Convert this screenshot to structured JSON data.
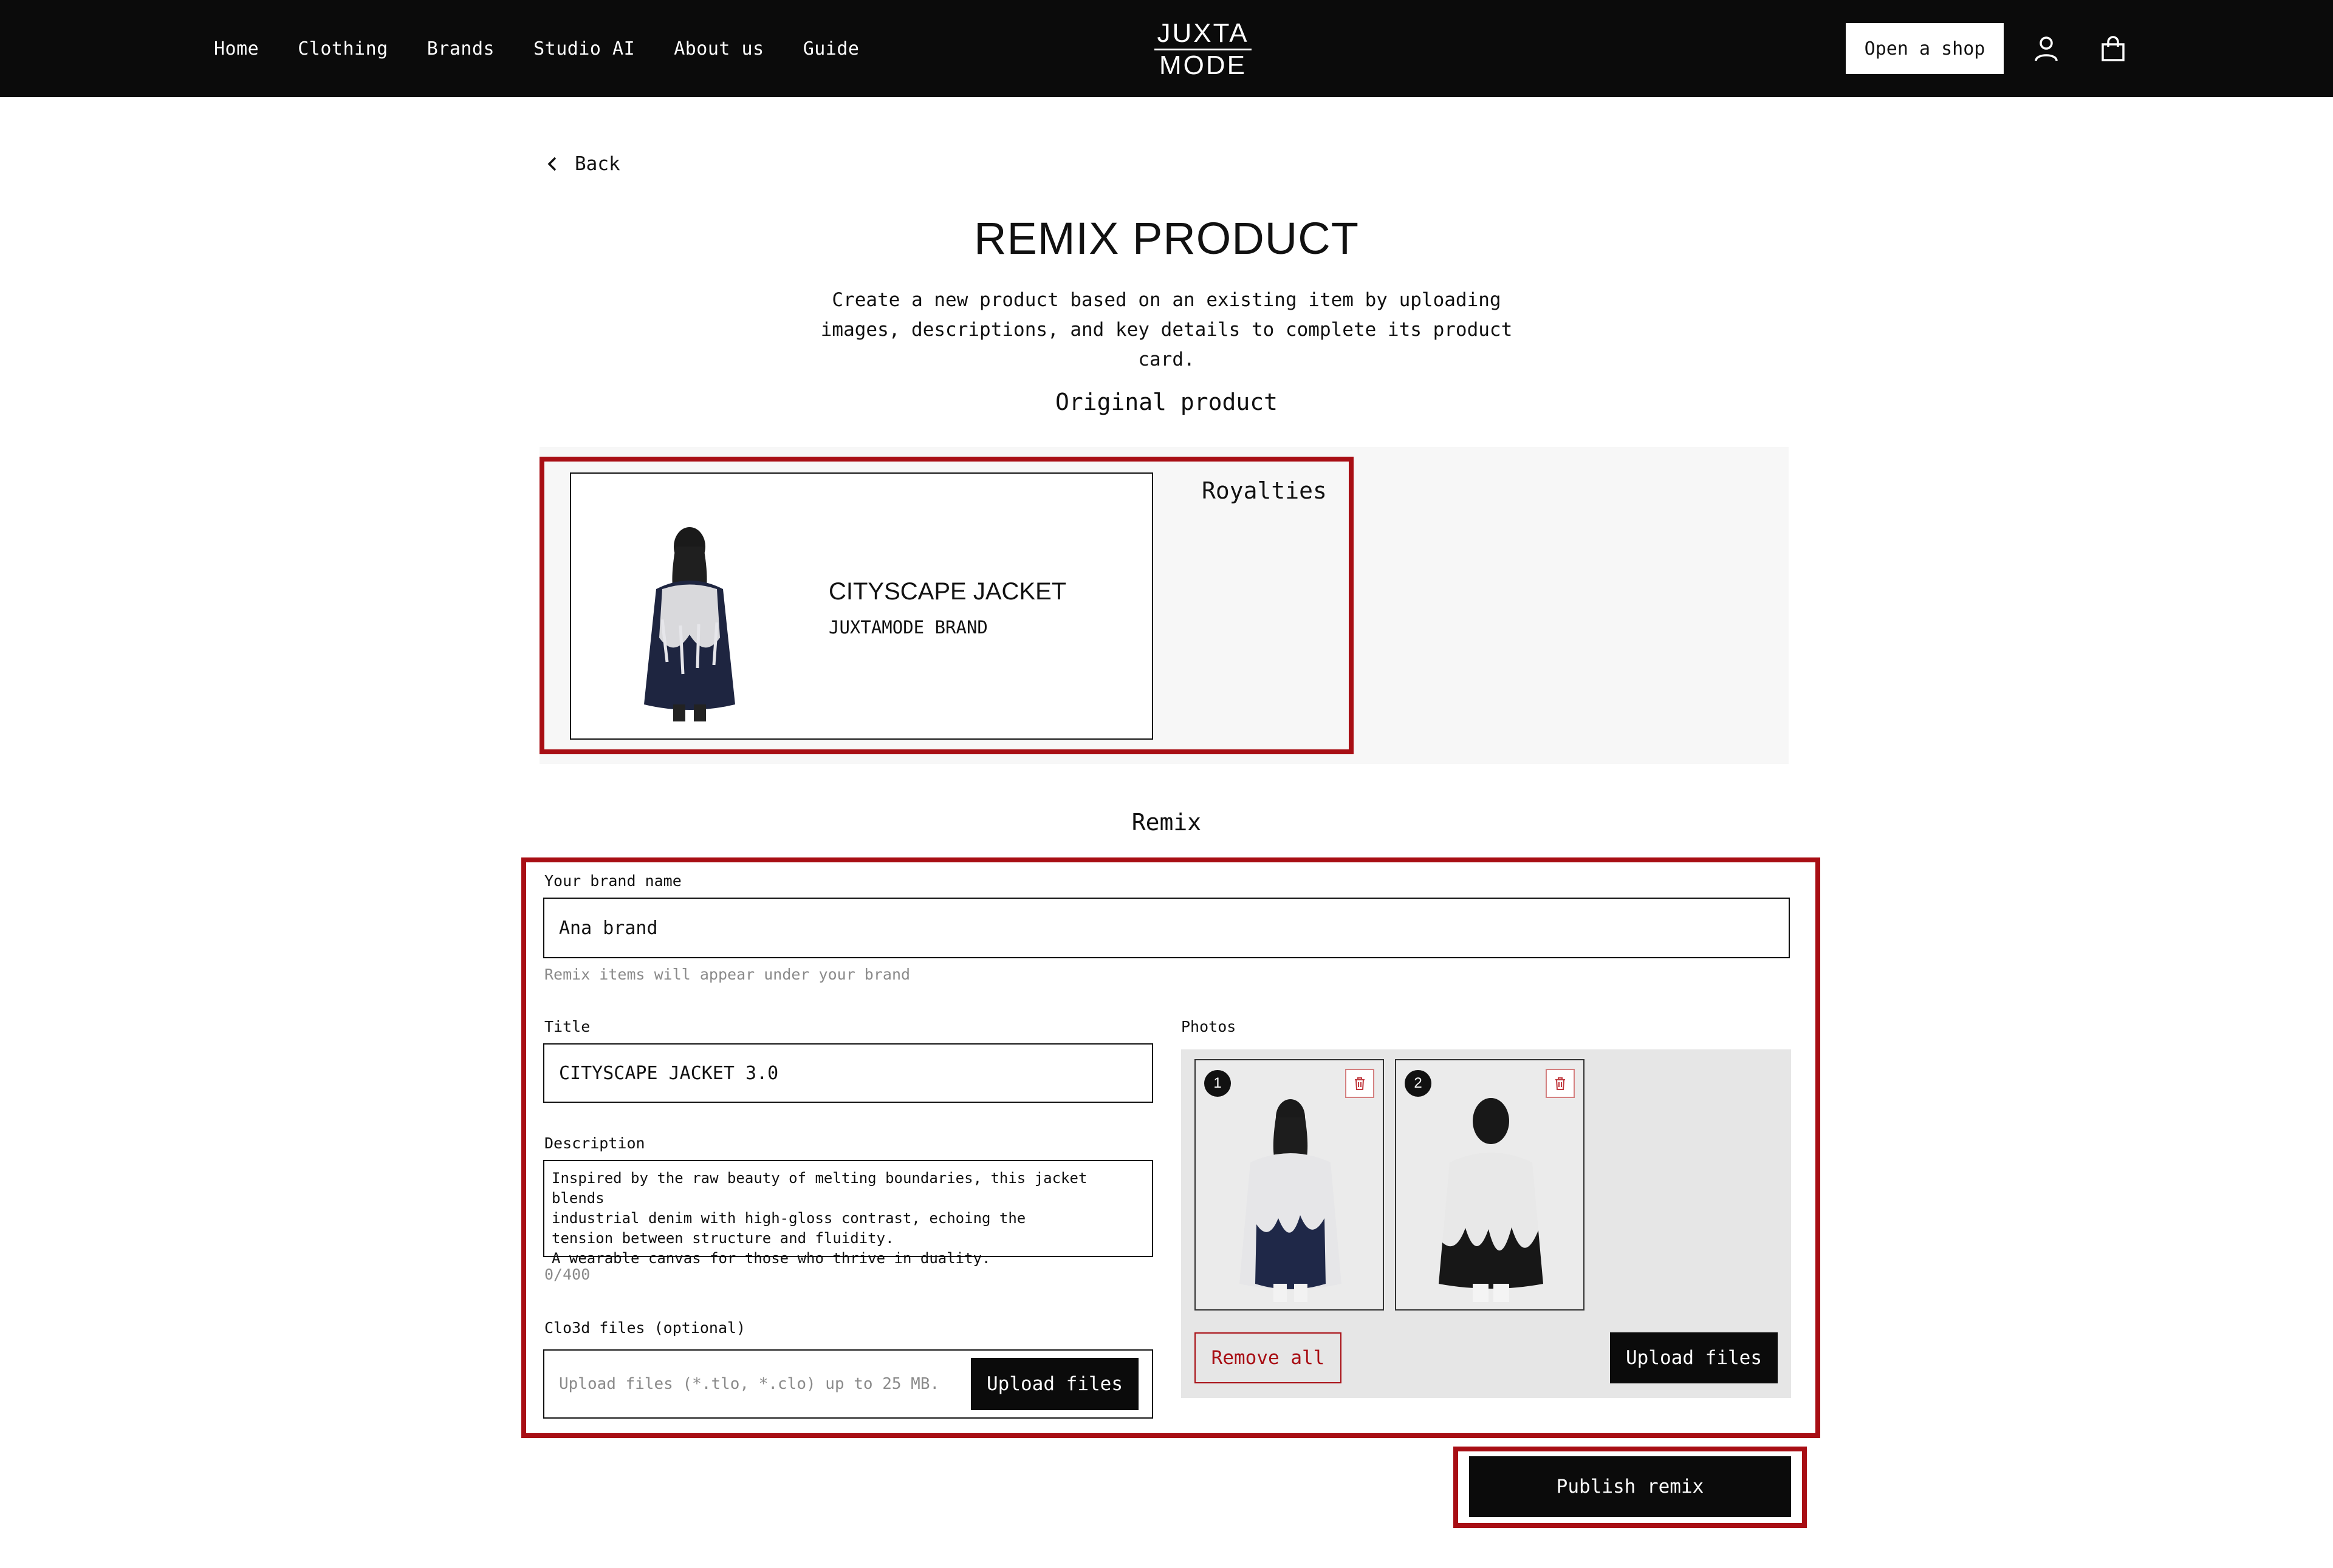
{
  "nav": {
    "items": [
      "Home",
      "Clothing",
      "Brands",
      "Studio AI",
      "About us",
      "Guide"
    ],
    "logo_line1": "JUXTA",
    "logo_line2": "MODE",
    "open_shop": "Open a shop",
    "icons": [
      "user-icon",
      "shopping-bag-icon"
    ]
  },
  "back_label": "Back",
  "page_title": "REMIX PRODUCT",
  "subtitle": "Create a new product based on an existing item by uploading images, descriptions, and key details to complete its product card.",
  "original": {
    "section_title": "Original product",
    "product_title": "CITYSCAPE JACKET",
    "product_brand": "JUXTAMODE BRAND",
    "royalties_label": "Royalties"
  },
  "remix": {
    "section_title": "Remix",
    "brand_label": "Your brand name",
    "brand_value": "Ana brand",
    "brand_hint": "Remix items will appear under your brand",
    "title_label": "Title",
    "title_value": "CITYSCAPE JACKET 3.0",
    "description_label": "Description",
    "description_value": "Inspired by the raw beauty of melting boundaries, this jacket blends\nindustrial denim with high-gloss contrast, echoing the\ntension between structure and fluidity.\nA wearable canvas for those who thrive in duality.",
    "char_count": "0/400",
    "files_label": "Clo3d files (optional)",
    "files_placeholder": "Upload files (*.tlo, *.clo) up to 25 MB.",
    "files_upload_button": "Upload files",
    "photos_label": "Photos",
    "photos": [
      {
        "number": "1"
      },
      {
        "number": "2"
      }
    ],
    "remove_all": "Remove all",
    "photos_upload_button": "Upload files",
    "publish": "Publish remix"
  },
  "colors": {
    "highlight": "#a80e14",
    "topbar": "#0b0b0b"
  }
}
